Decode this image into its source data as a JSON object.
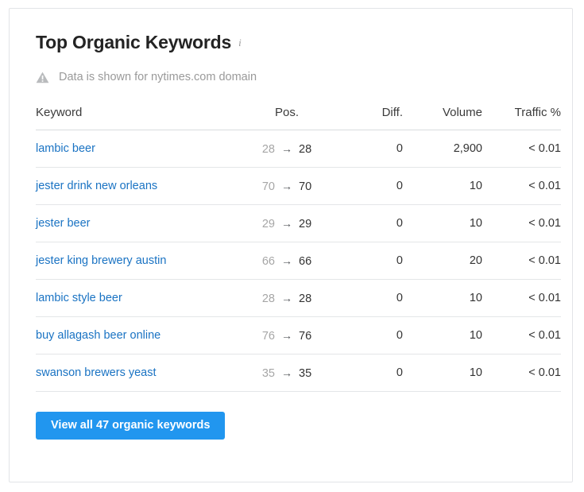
{
  "card": {
    "title": "Top Organic Keywords",
    "info_icon": "info-icon",
    "notice": {
      "icon": "warning-triangle-icon",
      "text": "Data is shown for nytimes.com domain"
    }
  },
  "table": {
    "headers": {
      "keyword": "Keyword",
      "pos": "Pos.",
      "diff": "Diff.",
      "volume": "Volume",
      "traffic": "Traffic %"
    },
    "arrow_glyph": "→",
    "rows": [
      {
        "keyword": "lambic beer",
        "pos_old": "28",
        "pos_new": "28",
        "diff": "0",
        "volume": "2,900",
        "traffic": "< 0.01"
      },
      {
        "keyword": "jester drink new orleans",
        "pos_old": "70",
        "pos_new": "70",
        "diff": "0",
        "volume": "10",
        "traffic": "< 0.01"
      },
      {
        "keyword": "jester beer",
        "pos_old": "29",
        "pos_new": "29",
        "diff": "0",
        "volume": "10",
        "traffic": "< 0.01"
      },
      {
        "keyword": "jester king brewery austin",
        "pos_old": "66",
        "pos_new": "66",
        "diff": "0",
        "volume": "20",
        "traffic": "< 0.01"
      },
      {
        "keyword": "lambic style beer",
        "pos_old": "28",
        "pos_new": "28",
        "diff": "0",
        "volume": "10",
        "traffic": "< 0.01"
      },
      {
        "keyword": "buy allagash beer online",
        "pos_old": "76",
        "pos_new": "76",
        "diff": "0",
        "volume": "10",
        "traffic": "< 0.01"
      },
      {
        "keyword": "swanson brewers yeast",
        "pos_old": "35",
        "pos_new": "35",
        "diff": "0",
        "volume": "10",
        "traffic": "< 0.01"
      }
    ]
  },
  "footer": {
    "view_all_label": "View all 47 organic keywords"
  },
  "colors": {
    "link": "#1a73c3",
    "button": "#2196ef",
    "muted": "#9a9a9a",
    "text": "#333333",
    "border": "#e2e4e7"
  }
}
